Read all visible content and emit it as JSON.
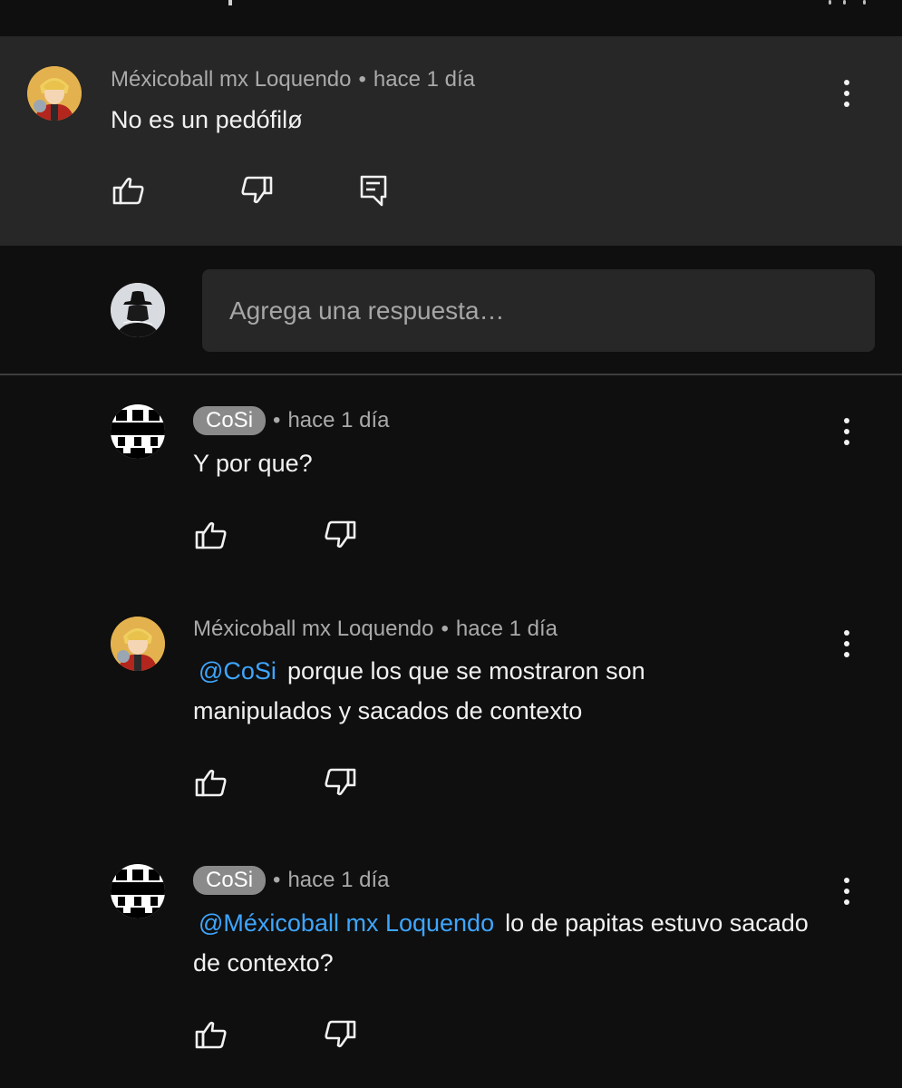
{
  "parent_comment": {
    "author": "Méxicoball mx Loquendo",
    "time": "hace 1 día",
    "text": "No es un pedófilø",
    "avatar_icon": "anime-character-avatar",
    "actions": [
      "like-icon",
      "dislike-icon",
      "reply-icon",
      "more-options-icon"
    ]
  },
  "reply_box": {
    "placeholder": "Agrega una respuesta…",
    "avatar_icon": "hat-silhouette-avatar"
  },
  "replies": [
    {
      "author": "CoSi",
      "author_is_chip": true,
      "time": "hace 1 día",
      "mention": "",
      "text": "Y por que?"
    },
    {
      "author": "Méxicoball mx Loquendo",
      "author_is_chip": false,
      "time": "hace 1 día",
      "mention": "@CoSi",
      "text": "porque los que se mostraron son manipulados y sacados de contexto"
    },
    {
      "author": "CoSi",
      "author_is_chip": true,
      "time": "hace 1 día",
      "mention": "@Méxicoball mx Loquendo",
      "text": "lo de papitas estuvo sacado de contexto?"
    }
  ],
  "separator": "•",
  "colors": {
    "background": "#0f0f0f",
    "highlight_background": "#272727",
    "text_primary": "#f1f1f1",
    "text_secondary": "#aaaaaa",
    "mention": "#3ea6ff",
    "chip": "#8a8a8a"
  }
}
